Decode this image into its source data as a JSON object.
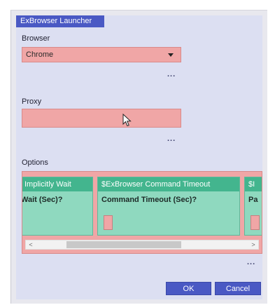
{
  "window": {
    "title": "ExBrowser Launcher"
  },
  "browser": {
    "label": "Browser",
    "selected": "Chrome",
    "more": "..."
  },
  "proxy": {
    "label": "Proxy",
    "value": "",
    "more": "..."
  },
  "options": {
    "label": "Options",
    "cards": [
      {
        "header": "Implicitly Wait",
        "field_label": "Wait (Sec)?"
      },
      {
        "header": "$ExBrowser Command Timeout",
        "field_label": "Command Timeout (Sec)?"
      },
      {
        "header": "$I",
        "field_label": "Pa"
      }
    ],
    "more": "..."
  },
  "buttons": {
    "ok": "OK",
    "cancel": "Cancel"
  },
  "colors": {
    "accent": "#4a59c4",
    "panel_bg": "#dcdff2",
    "required_field": "#f0a6a6",
    "card_bg": "#8fd9bf",
    "card_header": "#43b58e"
  },
  "icons": {
    "dropdown": "chevron-down-icon",
    "pointer": "mouse-pointer-icon",
    "scroll_left": "scroll-left-icon",
    "scroll_right": "scroll-right-icon"
  }
}
